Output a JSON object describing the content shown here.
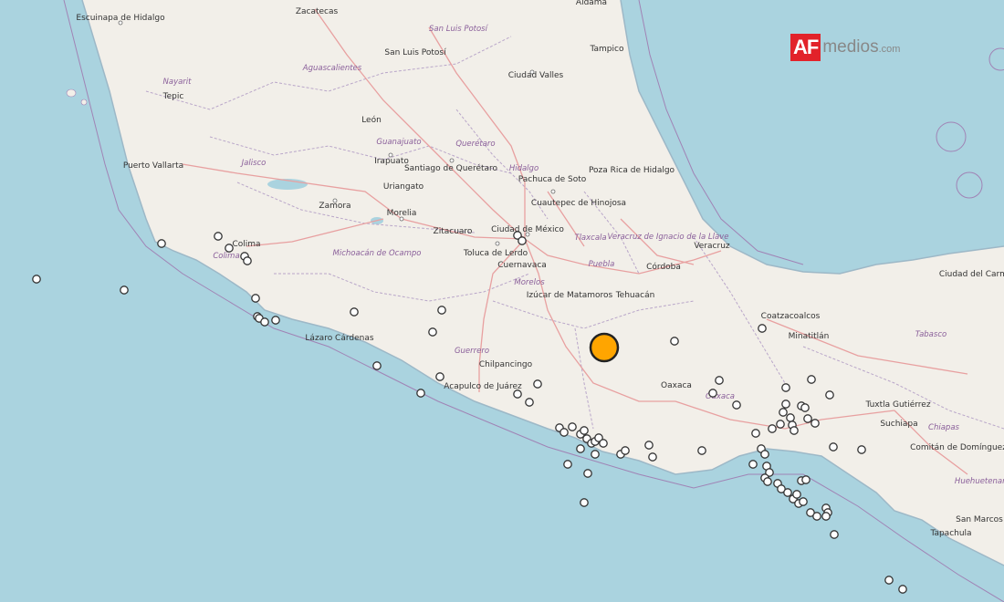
{
  "logo": {
    "box": "AF",
    "text": "medios",
    "suffix": ".com"
  },
  "colors": {
    "water": "#aad3df",
    "land": "#f2efe9",
    "highway": "#e8a0a0",
    "border": "#a083b5",
    "quake": "#ffa500"
  },
  "cities": [
    "Escuinapa de Hidalgo",
    "Zacatecas",
    "San Luis Potosí",
    "Aldama",
    "Tampico",
    "Ciudad Valles",
    "Tepic",
    "León",
    "Irapuato",
    "Santiago de Querétaro",
    "Puerto Vallarta",
    "Uriangato",
    "Pachuca de Soto",
    "Poza Rica de Hidalgo",
    "Zamora",
    "Morelia",
    "Cuautepec de Hinojosa",
    "Colima",
    "Zitacuaro",
    "Ciudad de México",
    "Toluca de Lerdo",
    "Veracruz",
    "Cuernavaca",
    "Córdoba",
    "Ciudad del Carmen",
    "Izúcar de Matamoros",
    "Tehuacán",
    "Coatzacoalcos",
    "Minatitlán",
    "Lázaro Cárdenas",
    "Chilpancingo",
    "Oaxaca",
    "Acapulco de Juárez",
    "Tuxtla Gutiérrez",
    "Suchiapa",
    "Comitán de Domínguez",
    "Tapachula",
    "San Marcos"
  ],
  "states": [
    "San Luis Potosí",
    "Nayarit",
    "Aguascalientes",
    "Guanajuato",
    "Querétaro",
    "Jalisco",
    "Hidalgo",
    "Veracruz de Ignacio de la Llave",
    "Tlaxcala",
    "Colima",
    "Michoacán de Ocampo",
    "Puebla",
    "Morelos",
    "Tabasco",
    "Guerrero",
    "Oaxaca",
    "Chiapas",
    "Huehuetenango"
  ],
  "mainshock": {
    "label": "epicenter"
  }
}
